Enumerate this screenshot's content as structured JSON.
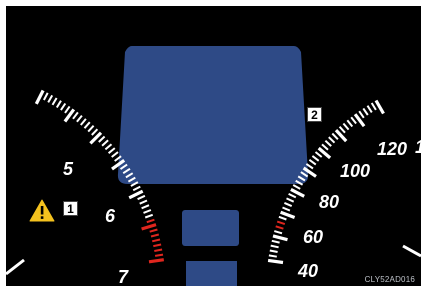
{
  "tachometer": {
    "labels": [
      "5",
      "6",
      "7"
    ],
    "tick_color": "#ffffff",
    "redzone_color": "#e0261e"
  },
  "speedometer": {
    "labels": [
      "40",
      "60",
      "80",
      "100",
      "120",
      "1"
    ],
    "tick_color": "#ffffff",
    "highlight_color": "#e0261e"
  },
  "display": {
    "color": "#2e4a86"
  },
  "callouts": {
    "one": "1",
    "two": "2"
  },
  "warning_icon": "warning-triangle-icon",
  "image_code": "CLY52AD016"
}
